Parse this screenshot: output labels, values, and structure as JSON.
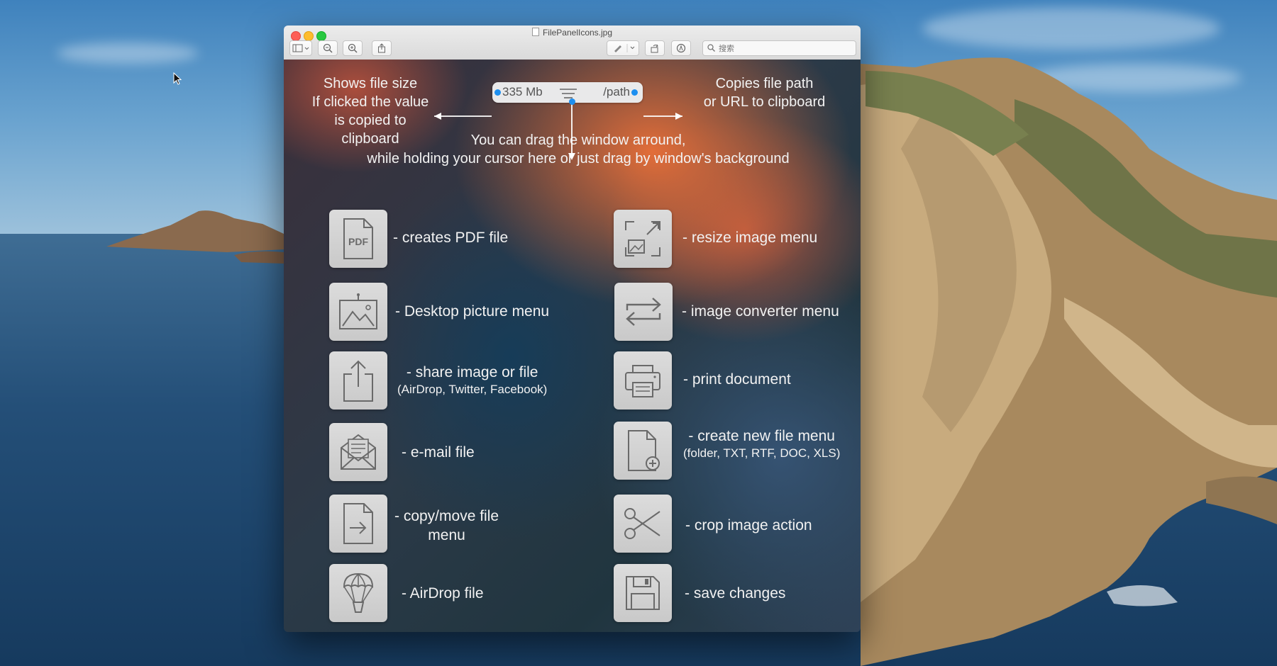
{
  "window": {
    "title": "FilePanelIcons.jpg",
    "search_placeholder": "搜索"
  },
  "toolbar": {
    "buttons": [
      "sidebar-toggle",
      "zoom-out",
      "zoom-in",
      "share",
      "markup-pen",
      "rotate",
      "annotate"
    ]
  },
  "panel": {
    "file_size": "335 Mb",
    "path": "/path"
  },
  "annotations": {
    "size_note": [
      "Shows file size",
      "If clicked the value",
      "is copied to clipboard"
    ],
    "path_note": [
      "Copies file path",
      "or URL to clipboard"
    ],
    "drag_note": [
      "You can drag the window arround,",
      "while holding your cursor here or just drag by window's background"
    ]
  },
  "features": [
    {
      "icon": "pdf-icon",
      "label": "- creates PDF file",
      "sub": ""
    },
    {
      "icon": "resize-image-icon",
      "label": "- resize image menu",
      "sub": ""
    },
    {
      "icon": "desktop-picture-icon",
      "label": "- Desktop picture menu",
      "sub": ""
    },
    {
      "icon": "image-converter-icon",
      "label": "- image converter menu",
      "sub": ""
    },
    {
      "icon": "share-icon",
      "label": "- share image or file",
      "sub": "(AirDrop, Twitter, Facebook)"
    },
    {
      "icon": "print-icon",
      "label": "- print document",
      "sub": ""
    },
    {
      "icon": "email-icon",
      "label": "- e-mail file",
      "sub": ""
    },
    {
      "icon": "new-file-icon",
      "label": "- create new file menu",
      "sub": "(folder, TXT, RTF, DOC, XLS)"
    },
    {
      "icon": "copy-move-file-icon",
      "label": "- copy/move file",
      "sub": "menu"
    },
    {
      "icon": "scissors-icon",
      "label": "- crop image action",
      "sub": ""
    },
    {
      "icon": "airdrop-icon",
      "label": "- AirDrop file",
      "sub": ""
    },
    {
      "icon": "floppy-disk-icon",
      "label": "- save changes",
      "sub": ""
    }
  ],
  "colors": {
    "accent_dot": "#1d8ff0",
    "close": "#fd5f57",
    "minimize": "#febc2e",
    "maximize": "#28c840"
  }
}
